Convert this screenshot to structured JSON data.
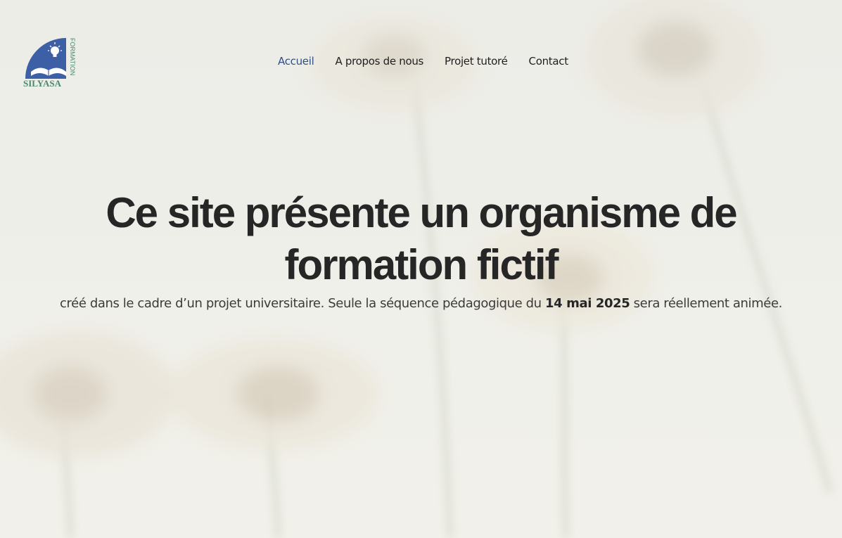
{
  "brand": {
    "logo_text": "SILYASA",
    "logo_subtext": "FORMATION"
  },
  "nav": {
    "items": [
      {
        "label": "Accueil",
        "active": true
      },
      {
        "label": "A propos de nous",
        "active": false
      },
      {
        "label": "Projet tutoré",
        "active": false
      },
      {
        "label": "Contact",
        "active": false
      }
    ]
  },
  "hero": {
    "title_line1": "Ce site présente un organisme de",
    "title_line2": "formation fictif",
    "subtitle_before": "créé dans le cadre d’un projet universitaire. Seule la séquence pédagogique du ",
    "subtitle_date": "14 mai 2025",
    "subtitle_after": " sera réellement animée."
  },
  "colors": {
    "nav_active": "#2f4f86",
    "text_dark": "#262626",
    "logo_blue": "#3d5fa6",
    "logo_green": "#4a8a6a"
  }
}
